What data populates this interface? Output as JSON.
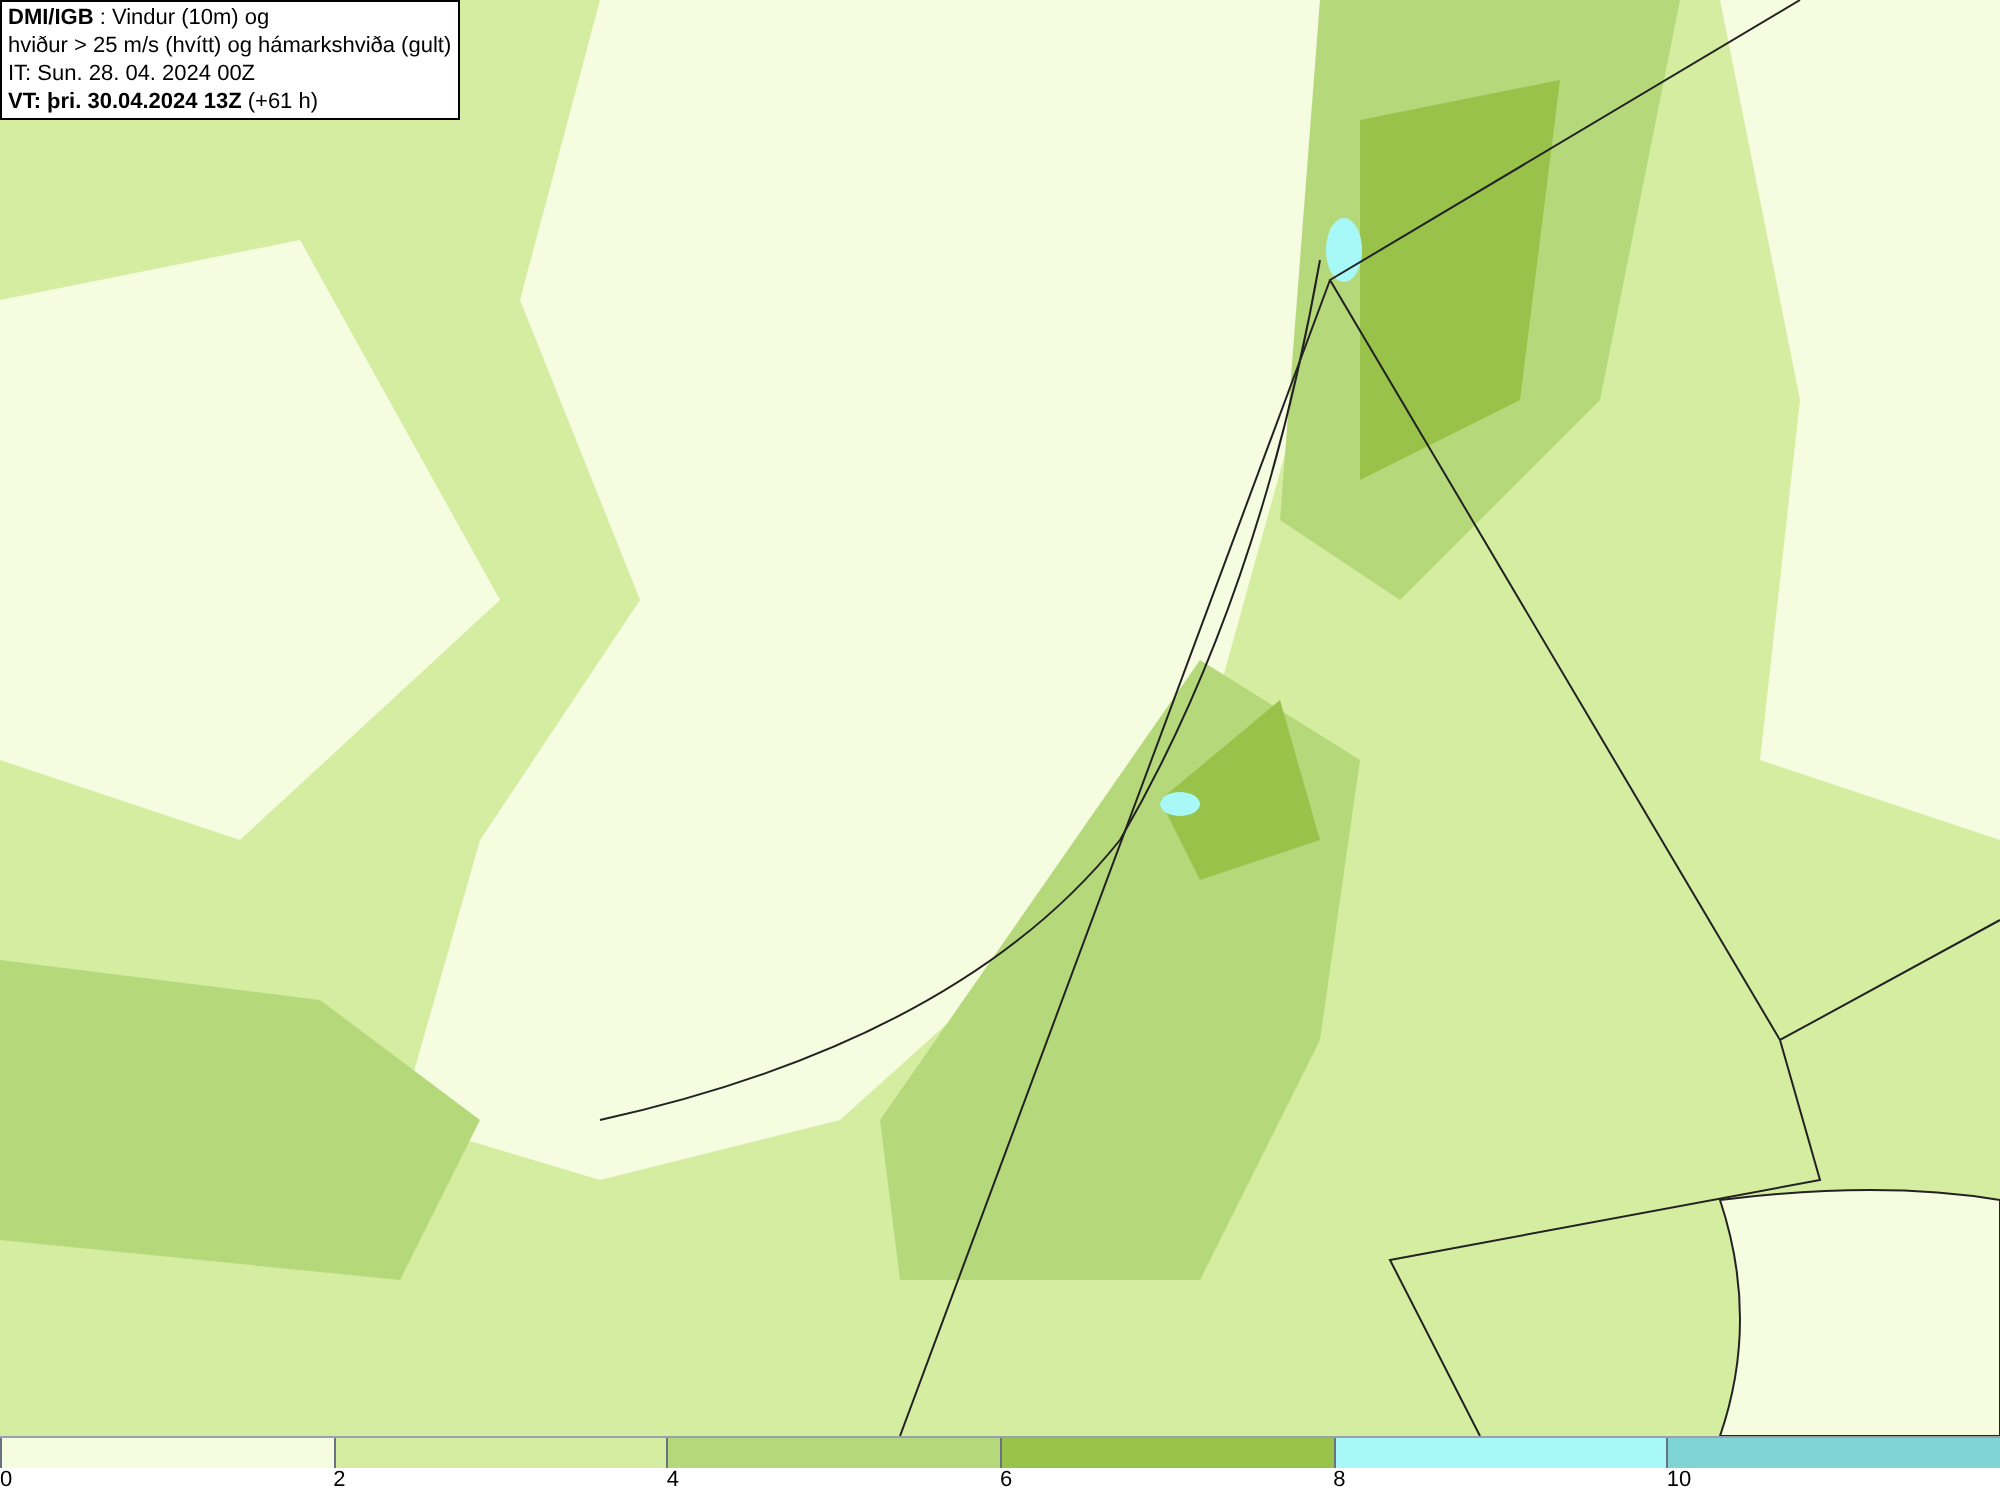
{
  "header": {
    "lines": [
      "**DMI/IGB** : Vindur (10m) og",
      "hviður > 25 m/s (hvítt) og hámarkshviða (gult)",
      "IT: Sun. 28. 04. 2024 00Z",
      "**VT: þri. 30.04.2024 13Z** (+61 h)"
    ]
  },
  "legend": [
    {
      "label": "0",
      "color": "#f5fce0"
    },
    {
      "label": "2",
      "color": "#d4eda0"
    },
    {
      "label": "4",
      "color": "#b5d97a"
    },
    {
      "label": "6",
      "color": "#98c24a"
    },
    {
      "label": "8",
      "color": "#a8f8f8"
    },
    {
      "label": "10",
      "color": "#7fd4d4"
    }
  ]
}
